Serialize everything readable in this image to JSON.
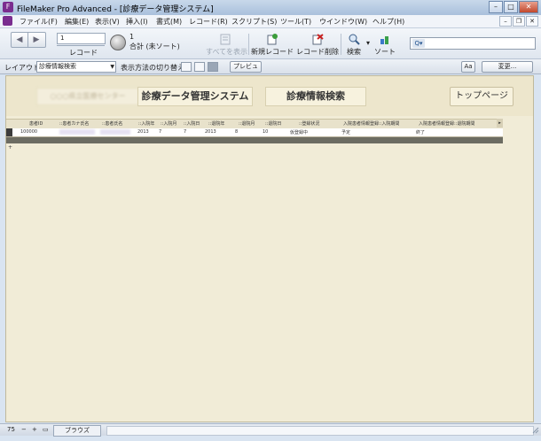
{
  "window": {
    "title": "FileMaker Pro Advanced - [診療データ管理システム]",
    "app_icon": "filemaker-icon",
    "controls": [
      "minimize-icon",
      "maximize-icon",
      "close-icon"
    ]
  },
  "menubar": {
    "items": [
      "ファイル(F)",
      "編集(E)",
      "表示(V)",
      "挿入(I)",
      "書式(M)",
      "レコード(R)",
      "スクリプト(S)",
      "ツール(T)",
      "ウインドウ(W)",
      "ヘルプ(H)"
    ]
  },
  "toolbar": {
    "record_label": "レコード",
    "record_value": "1",
    "found_count": "1",
    "total_label": "合計 (未ソート)",
    "show_all": "すべてを表示",
    "new_record": "新規レコード",
    "delete_record": "レコード削除",
    "find": "検索",
    "sort": "ソート",
    "search_placeholder": ""
  },
  "layoutbar": {
    "layout_label": "レイアウト:",
    "layout_value": "診療情報検索",
    "view_label": "表示方法の切り替え:",
    "preview": "プレビュー",
    "aa": "Aa",
    "edit": "変更..."
  },
  "header": {
    "blurred_org": "○○○県立医療センター",
    "system_title": "診療データ管理システム",
    "screen_title": "診療情報検索",
    "top_button": "トップページ"
  },
  "table": {
    "columns": [
      "患者ID",
      "::患者カナ氏名",
      "::患者氏名",
      "::入院年",
      "::入院月",
      "::入院日",
      "::退院年",
      "::退院月",
      "::退院日",
      "::登録状況",
      "入院患者情報登録::入院期間",
      "入院患者情報登録::退院期間"
    ],
    "rows": [
      [
        "100000",
        "",
        "",
        "2013",
        "7",
        "7",
        "2013",
        "8",
        "10",
        "仮登録中",
        "予定",
        "終了"
      ]
    ],
    "new_row_marker": "+"
  },
  "status": {
    "zoom": "75",
    "mode": "ブラウズ"
  }
}
